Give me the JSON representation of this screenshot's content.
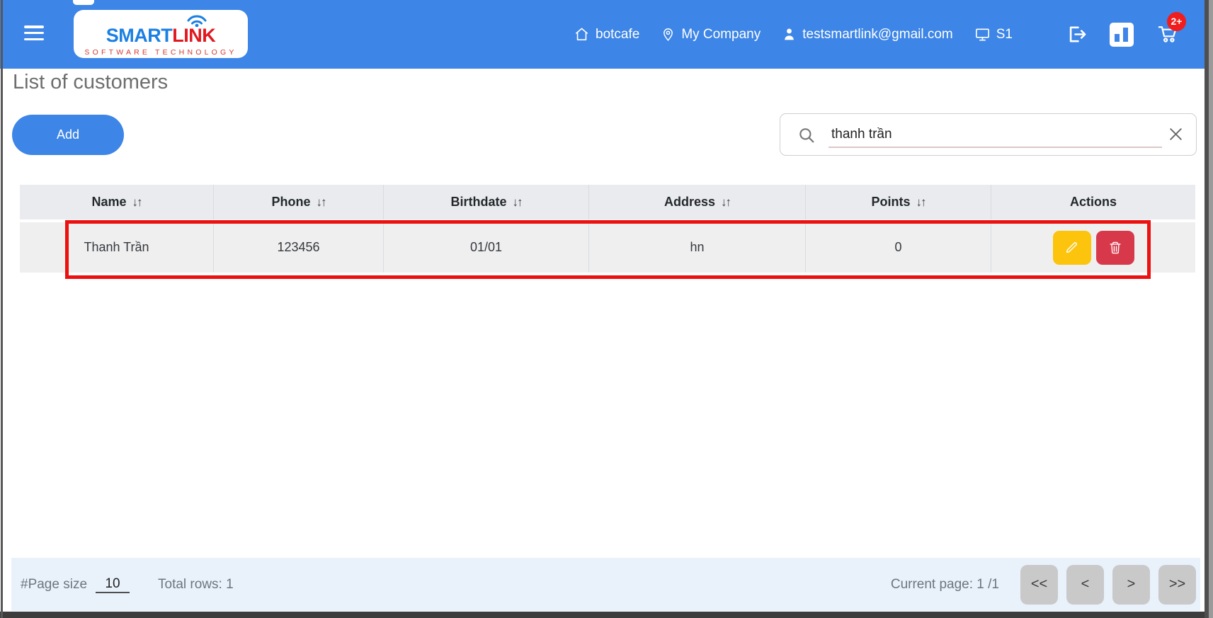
{
  "header": {
    "logo": {
      "brand_blue": "SMART",
      "brand_red": "LINK",
      "tagline": "SOFTWARE TECHNOLOGY"
    },
    "nav": {
      "site": "botcafe",
      "company": "My Company",
      "account": "testsmartlink@gmail.com",
      "station": "S1"
    },
    "cart_badge": "2+"
  },
  "page": {
    "title": "List of customers"
  },
  "toolbar": {
    "add_label": "Add"
  },
  "search": {
    "value": "thanh trần"
  },
  "table": {
    "sort_glyph": "↓↑",
    "columns": [
      "Name",
      "Phone",
      "Birthdate",
      "Address",
      "Points",
      "Actions"
    ],
    "rows": [
      {
        "name": "Thanh Trần",
        "phone": "123456",
        "birthdate": "01/01",
        "address": "hn",
        "points": "0"
      }
    ]
  },
  "footer": {
    "page_size_label": "#Page size",
    "page_size_value": "10",
    "total_rows": "Total rows: 1",
    "current_page": "Current page: 1 /1",
    "pagination": {
      "first": "<<",
      "prev": "<",
      "next": ">",
      "last": ">>"
    }
  },
  "colors": {
    "accent": "#3d85e6",
    "warning": "#fcc40d",
    "danger": "#d7394b",
    "annotation_red": "#ec1111",
    "badge_red": "#f11d1d",
    "footer_bg": "#e9f1fb"
  }
}
